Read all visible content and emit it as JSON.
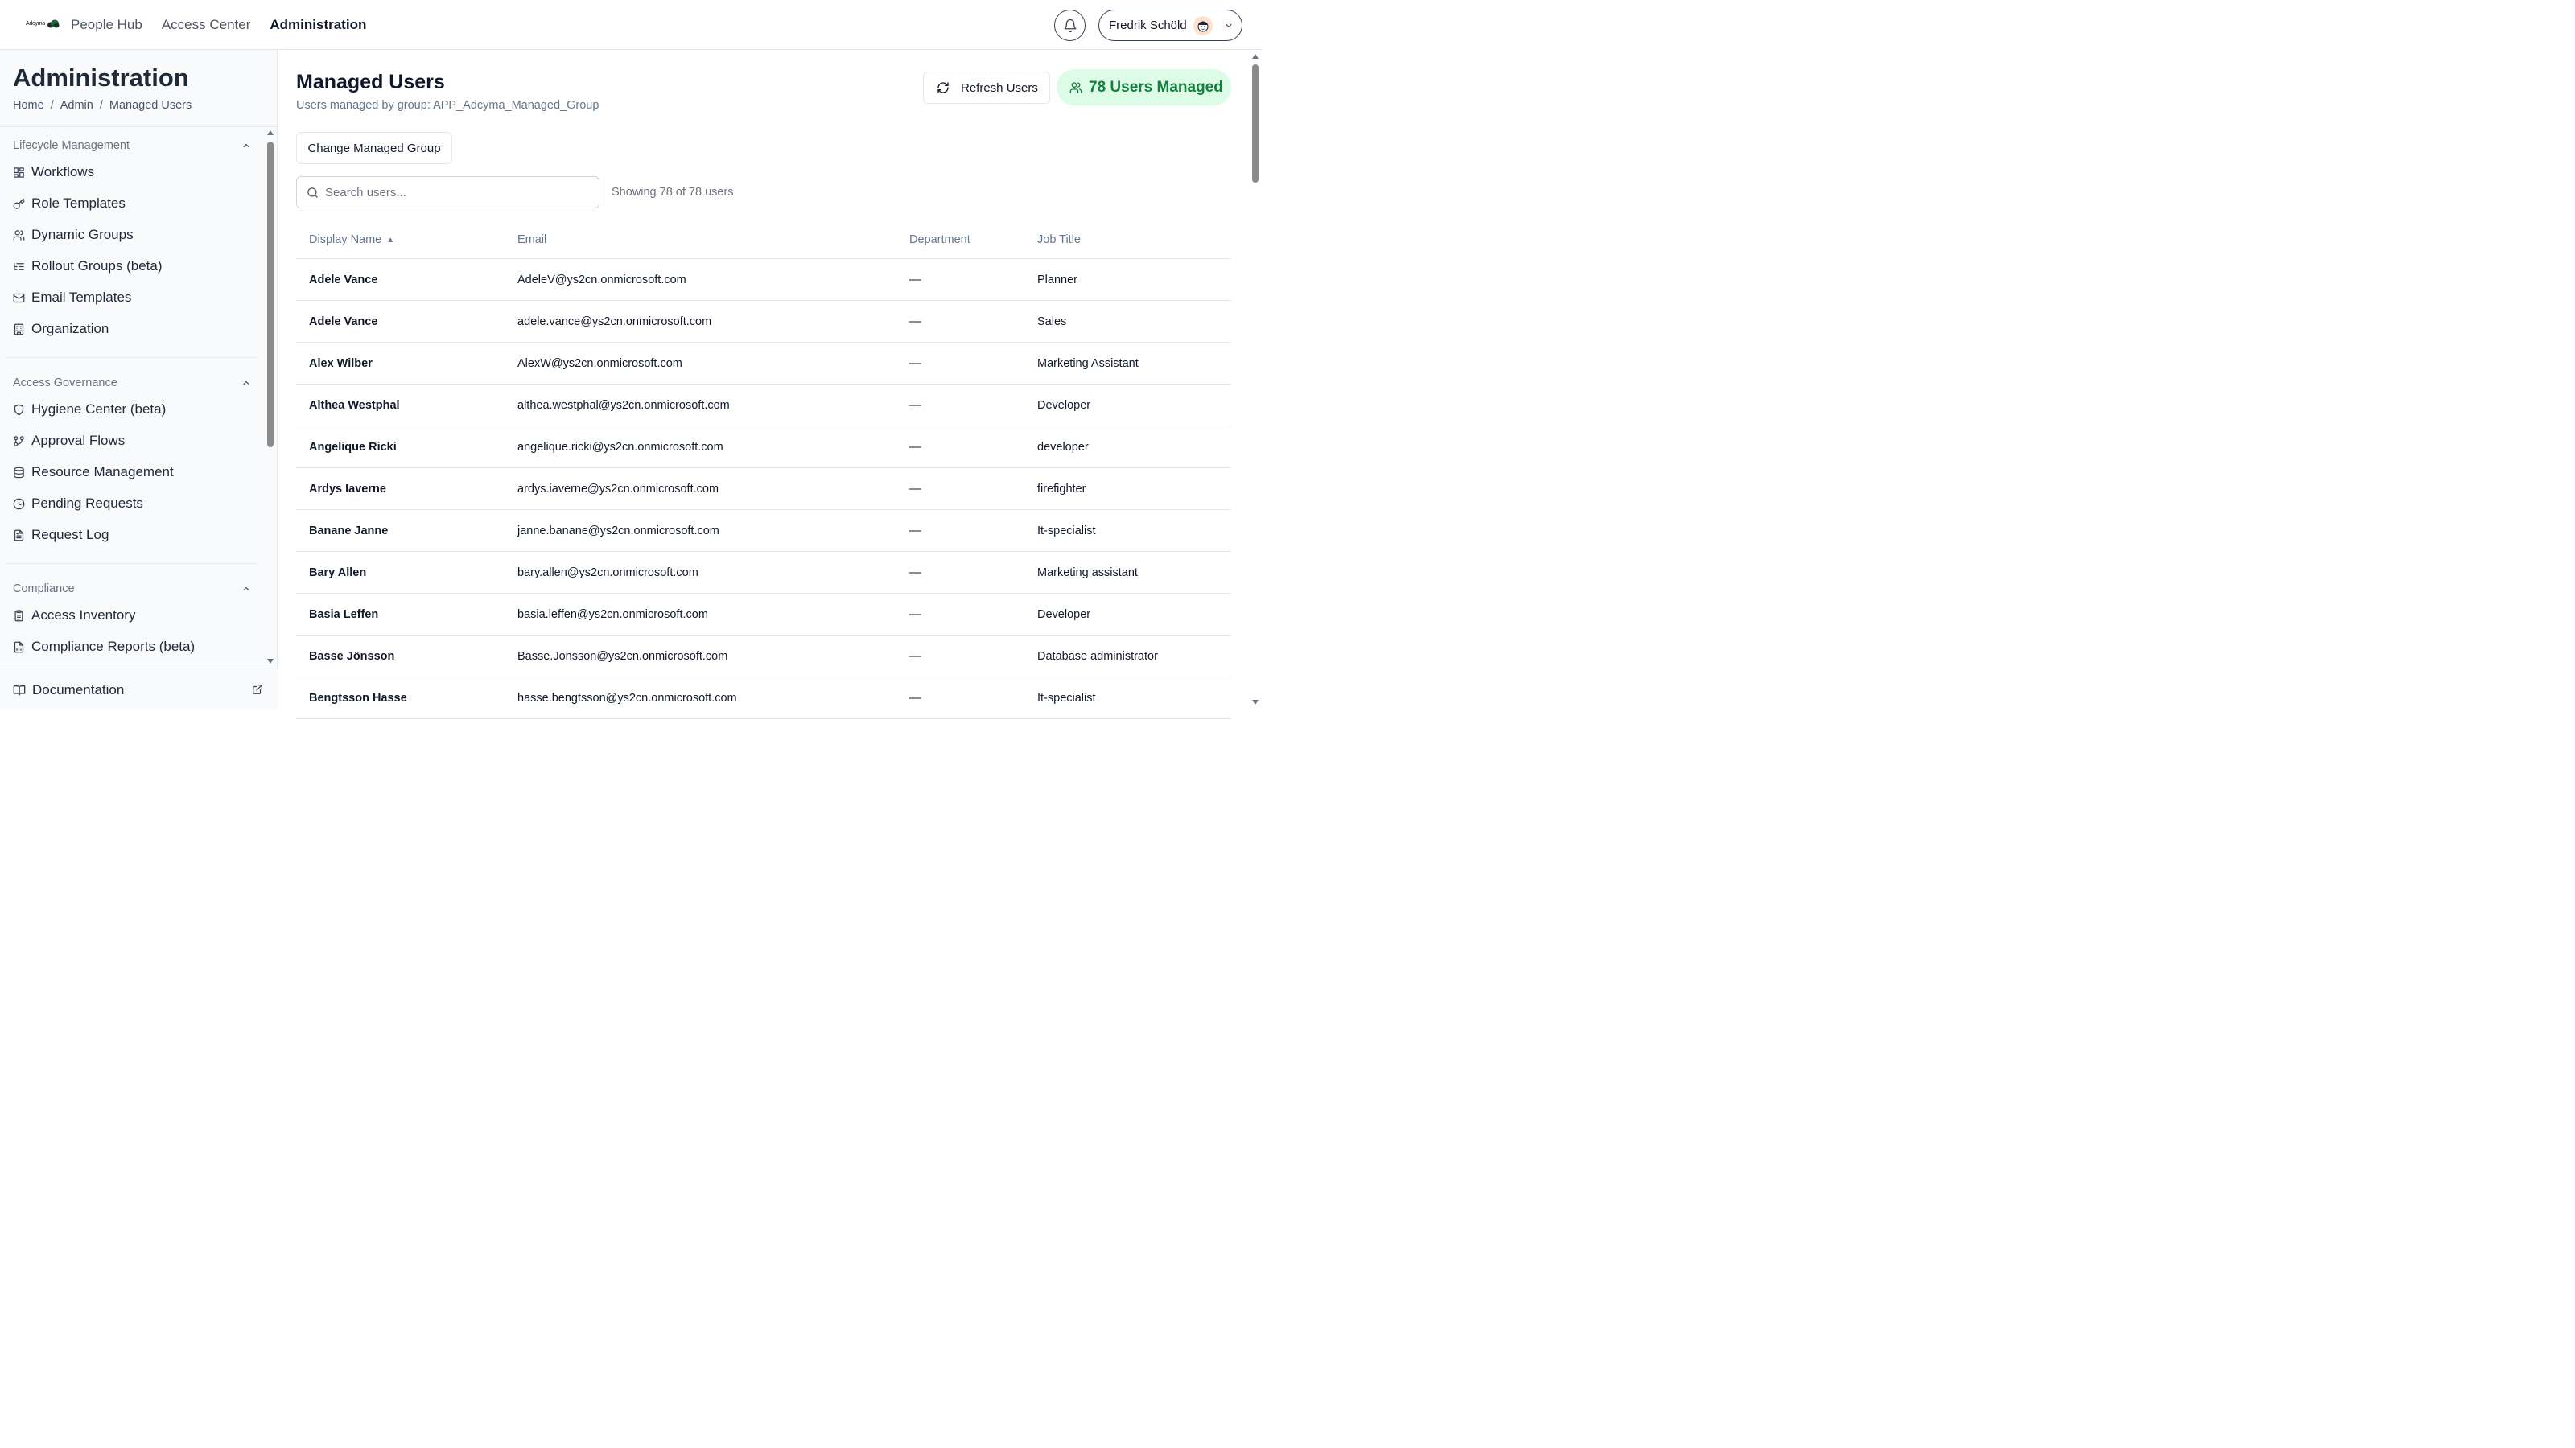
{
  "header": {
    "logo_text": "Adcyma",
    "nav": [
      {
        "label": "People Hub",
        "active": false
      },
      {
        "label": "Access Center",
        "active": false
      },
      {
        "label": "Administration",
        "active": true
      }
    ],
    "user_name": "Fredrik Schöld"
  },
  "sidebar": {
    "title": "Administration",
    "breadcrumb": [
      "Home",
      "Admin",
      "Managed Users"
    ],
    "breadcrumb_sep": "/",
    "sections": [
      {
        "label": "Lifecycle Management",
        "items": [
          {
            "label": "Workflows",
            "icon": "layout-grid-icon"
          },
          {
            "label": "Role Templates",
            "icon": "key-icon"
          },
          {
            "label": "Dynamic Groups",
            "icon": "users-icon"
          },
          {
            "label": "Rollout Groups (beta)",
            "icon": "list-tree-icon"
          },
          {
            "label": "Email Templates",
            "icon": "mail-icon"
          },
          {
            "label": "Organization",
            "icon": "building-icon"
          }
        ]
      },
      {
        "label": "Access Governance",
        "items": [
          {
            "label": "Hygiene Center (beta)",
            "icon": "shield-icon"
          },
          {
            "label": "Approval Flows",
            "icon": "git-branch-icon"
          },
          {
            "label": "Resource Management",
            "icon": "database-icon"
          },
          {
            "label": "Pending Requests",
            "icon": "clock-icon"
          },
          {
            "label": "Request Log",
            "icon": "file-text-icon"
          }
        ]
      },
      {
        "label": "Compliance",
        "items": [
          {
            "label": "Access Inventory",
            "icon": "clipboard-list-icon"
          },
          {
            "label": "Compliance Reports (beta)",
            "icon": "file-chart-icon"
          }
        ]
      }
    ],
    "documentation_label": "Documentation"
  },
  "main": {
    "title": "Managed Users",
    "subtitle": "Users managed by group: APP_Adcyma_Managed_Group",
    "refresh_label": "Refresh Users",
    "managed_badge": "78 Users Managed",
    "change_group_label": "Change Managed Group",
    "search_placeholder": "Search users...",
    "showing_text": "Showing 78 of 78 users",
    "columns": [
      "Display Name",
      "Email",
      "Department",
      "Job Title"
    ],
    "sort_indicator": "▲",
    "rows": [
      {
        "name": "Adele Vance",
        "email": "AdeleV@ys2cn.onmicrosoft.com",
        "department": "—",
        "title": "Planner"
      },
      {
        "name": "Adele Vance",
        "email": "adele.vance@ys2cn.onmicrosoft.com",
        "department": "—",
        "title": "Sales"
      },
      {
        "name": "Alex Wilber",
        "email": "AlexW@ys2cn.onmicrosoft.com",
        "department": "—",
        "title": "Marketing Assistant"
      },
      {
        "name": "Althea Westphal",
        "email": "althea.westphal@ys2cn.onmicrosoft.com",
        "department": "—",
        "title": "Developer"
      },
      {
        "name": "Angelique Ricki",
        "email": "angelique.ricki@ys2cn.onmicrosoft.com",
        "department": "—",
        "title": "developer"
      },
      {
        "name": "Ardys Iaverne",
        "email": "ardys.iaverne@ys2cn.onmicrosoft.com",
        "department": "—",
        "title": "firefighter"
      },
      {
        "name": "Banane Janne",
        "email": "janne.banane@ys2cn.onmicrosoft.com",
        "department": "—",
        "title": "It-specialist"
      },
      {
        "name": "Bary Allen",
        "email": "bary.allen@ys2cn.onmicrosoft.com",
        "department": "—",
        "title": "Marketing assistant"
      },
      {
        "name": "Basia Leffen",
        "email": "basia.leffen@ys2cn.onmicrosoft.com",
        "department": "—",
        "title": "Developer"
      },
      {
        "name": "Basse Jönsson",
        "email": "Basse.Jonsson@ys2cn.onmicrosoft.com",
        "department": "—",
        "title": "Database administrator"
      },
      {
        "name": "Bengtsson Hasse",
        "email": "hasse.bengtsson@ys2cn.onmicrosoft.com",
        "department": "—",
        "title": "It-specialist"
      }
    ]
  },
  "colors": {
    "badge_bg": "#dcfce7",
    "badge_text": "#15803d",
    "sidebar_bg": "#f9fafb"
  }
}
